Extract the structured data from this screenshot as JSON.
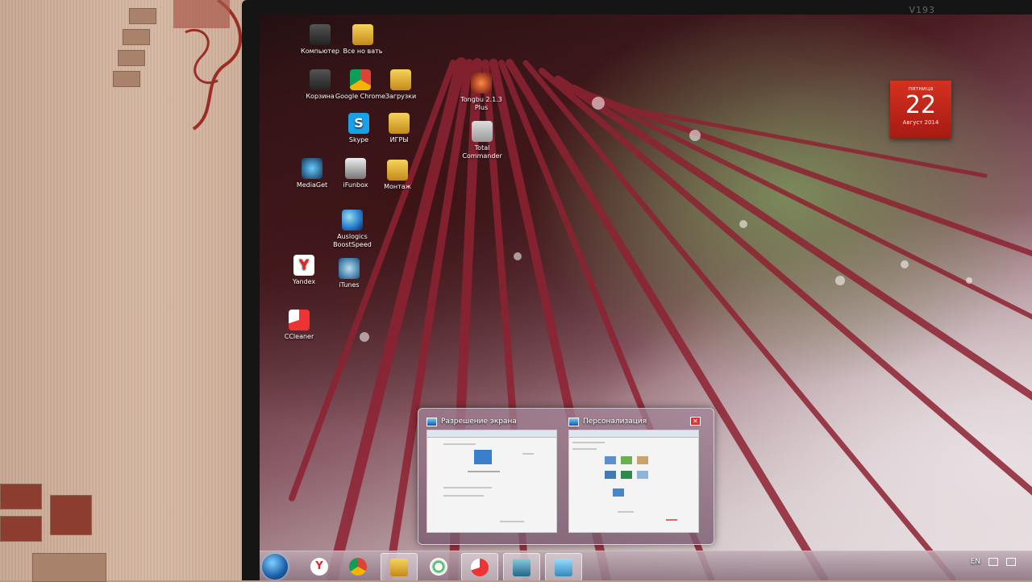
{
  "monitor": {
    "brand": "V193"
  },
  "desktop_icons": [
    {
      "label": "Компьютер",
      "icon": "computer-icon"
    },
    {
      "label": "Все но вать",
      "icon": "folder-icon"
    },
    {
      "label": "Корзина",
      "icon": "recycle-bin-icon"
    },
    {
      "label": "Google Chrome",
      "icon": "chrome-icon"
    },
    {
      "label": "Загрузки",
      "icon": "folder-icon"
    },
    {
      "label": "Tongbu 2.1.3 Plus",
      "icon": "tongbu-icon"
    },
    {
      "label": "Skype",
      "icon": "skype-icon"
    },
    {
      "label": "ИГРЫ",
      "icon": "folder-icon"
    },
    {
      "label": "Total Commander",
      "icon": "total-commander-icon"
    },
    {
      "label": "MediaGet",
      "icon": "mediaget-icon"
    },
    {
      "label": "iFunbox",
      "icon": "ifunbox-icon"
    },
    {
      "label": "Монтаж",
      "icon": "folder-icon"
    },
    {
      "label": "Auslogics BoostSpeed",
      "icon": "boostspeed-icon"
    },
    {
      "label": "Yandex",
      "icon": "yandex-icon"
    },
    {
      "label": "iTunes",
      "icon": "itunes-icon"
    },
    {
      "label": "CCleaner",
      "icon": "ccleaner-icon"
    }
  ],
  "calendar": {
    "weekday": "пятница",
    "day": "22",
    "month_year": "Август 2014"
  },
  "flyout": {
    "thumbnails": [
      {
        "title": "Разрешение экрана"
      },
      {
        "title": "Персонализация"
      }
    ],
    "close_glyph": "✕"
  },
  "taskbar": {
    "pinned": [
      "yandex-icon",
      "chrome-icon",
      "explorer-icon",
      "mediaget-icon",
      "ccleaner-icon",
      "control-panel-icon",
      "display-settings-icon"
    ],
    "tray_language": "EN"
  }
}
